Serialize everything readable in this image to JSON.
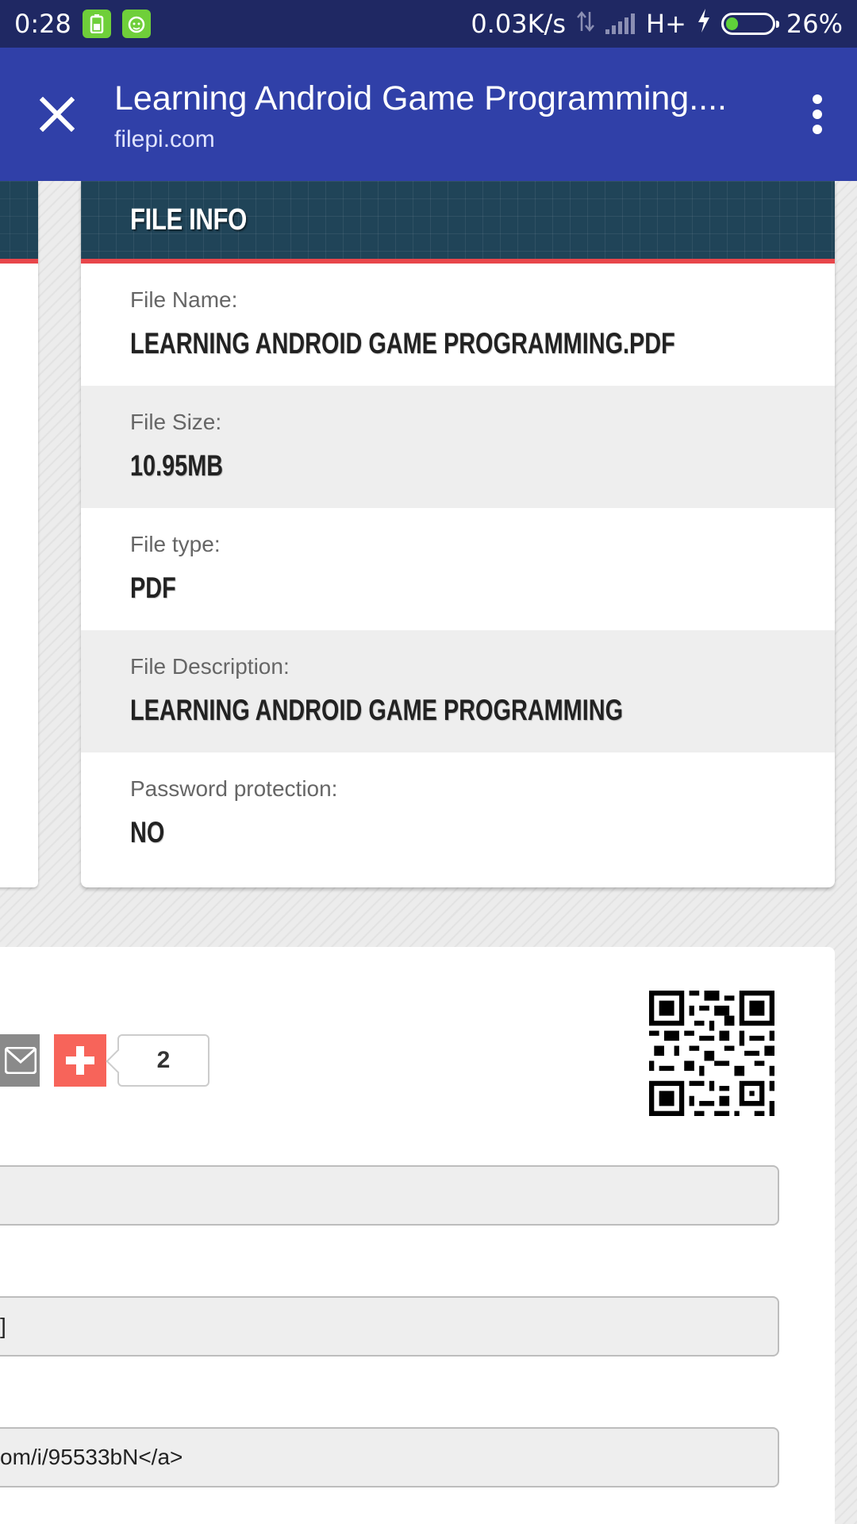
{
  "status_bar": {
    "time": "0:28",
    "network_speed": "0.03K/s",
    "network_type": "H+",
    "battery_percent": "26%",
    "battery_level": 0.26,
    "icons": [
      "battery-saver-icon",
      "android-icon",
      "data-arrows-icon",
      "signal-icon",
      "charging-icon",
      "battery-icon"
    ]
  },
  "app_bar": {
    "title": "Learning Android Game Programming....",
    "host": "filepi.com",
    "close_icon": "close-icon",
    "menu_icon": "more-vert-icon",
    "color": "#3040a8"
  },
  "file_info": {
    "header": "FILE INFO",
    "rows": [
      {
        "label": "File Name:",
        "value": "LEARNING ANDROID GAME PROGRAMMING.PDF"
      },
      {
        "label": "File Size:",
        "value": "10.95MB"
      },
      {
        "label": "File type:",
        "value": "PDF"
      },
      {
        "label": "File Description:",
        "value": "LEARNING ANDROID GAME PROGRAMMING"
      },
      {
        "label": "Password protection:",
        "value": "NO"
      }
    ]
  },
  "share": {
    "share_count": "2",
    "mail_icon": "mail-icon",
    "plus_icon": "plus-icon",
    "plus_color": "#f7645a",
    "qr_icon": "qr-code-icon"
  },
  "fields": {
    "field1": "",
    "field2": "]",
    "field3": "om/i/95533bN</a>"
  },
  "colors": {
    "status_bar": "#1f2863",
    "card_header": "#204458",
    "accent_red": "#e8464b"
  }
}
